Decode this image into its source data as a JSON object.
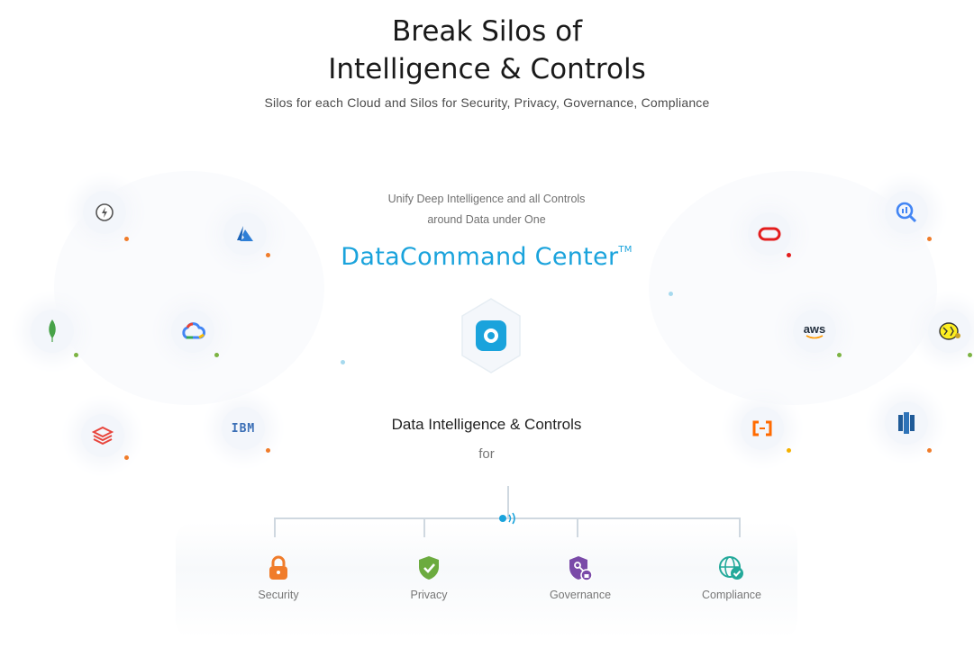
{
  "header": {
    "title_line1": "Break Silos of",
    "title_line2": "Intelligence & Controls",
    "subtitle": "Silos for each Cloud and Silos for Security, Privacy, Governance, Compliance"
  },
  "center": {
    "unify_line1": "Unify Deep Intelligence and all Controls",
    "unify_line2": "around Data under One",
    "product_name": "DataCommand Center",
    "trademark": "TM",
    "heading": "Data Intelligence & Controls",
    "for_text": "for"
  },
  "integrations": {
    "left": [
      {
        "icon": "snowflake-power-icon"
      },
      {
        "icon": "azure-icon"
      },
      {
        "icon": "mongodb-icon"
      },
      {
        "icon": "google-cloud-icon"
      },
      {
        "icon": "databricks-icon"
      },
      {
        "icon": "ibm-icon",
        "text": "IBM"
      }
    ],
    "right": [
      {
        "icon": "oracle-icon"
      },
      {
        "icon": "bigquery-icon"
      },
      {
        "icon": "aws-icon",
        "text": "aws"
      },
      {
        "icon": "hive-icon"
      },
      {
        "icon": "alibaba-cloud-icon"
      },
      {
        "icon": "redshift-icon"
      }
    ]
  },
  "categories": [
    {
      "label": "Security",
      "icon": "lock-icon",
      "color": "#f07c2a"
    },
    {
      "label": "Privacy",
      "icon": "shield-check-icon",
      "color": "#6cab3f"
    },
    {
      "label": "Governance",
      "icon": "governance-shield-icon",
      "color": "#7a4aa8"
    },
    {
      "label": "Compliance",
      "icon": "globe-check-icon",
      "color": "#23a99a"
    }
  ],
  "colors": {
    "accent": "#1aa3dc",
    "dot_orange": "#f07c2a",
    "dot_green": "#7cb342"
  }
}
